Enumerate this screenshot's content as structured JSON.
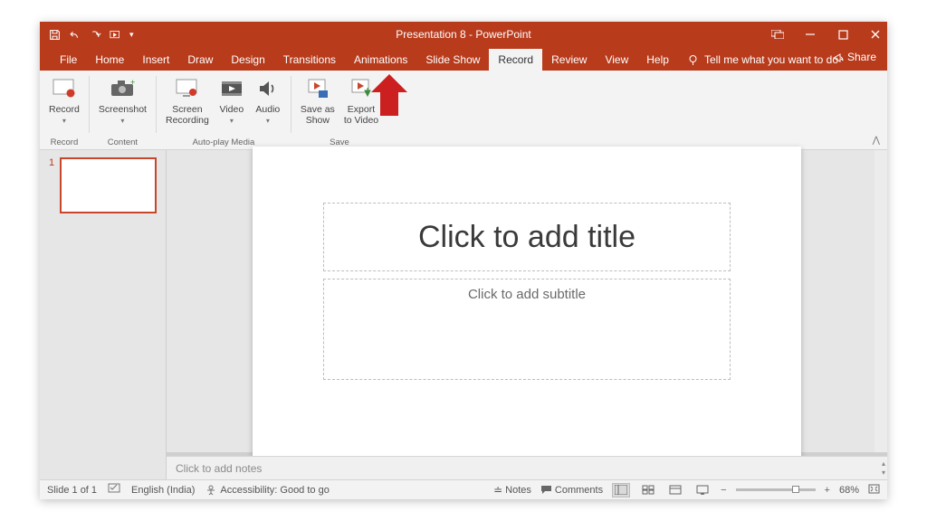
{
  "title": "Presentation 8  -  PowerPoint",
  "tabs": [
    "File",
    "Home",
    "Insert",
    "Draw",
    "Design",
    "Transitions",
    "Animations",
    "Slide Show",
    "Record",
    "Review",
    "View",
    "Help"
  ],
  "active_tab": "Record",
  "tellme": "Tell me what you want to do",
  "share": "Share",
  "ribbon": {
    "groups": [
      {
        "label": "Record",
        "items": [
          {
            "id": "record-button",
            "label": "Record",
            "sub": "▾",
            "icon": "record"
          }
        ]
      },
      {
        "label": "Content",
        "items": [
          {
            "id": "screenshot-button",
            "label": "Screenshot",
            "sub": "▾",
            "icon": "screenshot"
          }
        ]
      },
      {
        "label": "Auto-play Media",
        "items": [
          {
            "id": "screen-recording-button",
            "label": "Screen\nRecording",
            "icon": "screenrec"
          },
          {
            "id": "video-button",
            "label": "Video",
            "sub": "▾",
            "icon": "video"
          },
          {
            "id": "audio-button",
            "label": "Audio",
            "sub": "▾",
            "icon": "audio"
          }
        ]
      },
      {
        "label": "Save",
        "items": [
          {
            "id": "save-as-show-button",
            "label": "Save as\nShow",
            "icon": "saveas"
          },
          {
            "id": "export-to-video-button",
            "label": "Export\nto Video",
            "icon": "export"
          }
        ]
      }
    ]
  },
  "slide": {
    "number": "1",
    "title_placeholder": "Click to add title",
    "subtitle_placeholder": "Click to add subtitle"
  },
  "notes_placeholder": "Click to add notes",
  "status": {
    "slide": "Slide 1 of 1",
    "lang": "English (India)",
    "accessibility": "Accessibility: Good to go",
    "notes_btn": "Notes",
    "comments_btn": "Comments",
    "zoom_pct": "68%"
  },
  "colors": {
    "brand": "#b83b1c"
  }
}
